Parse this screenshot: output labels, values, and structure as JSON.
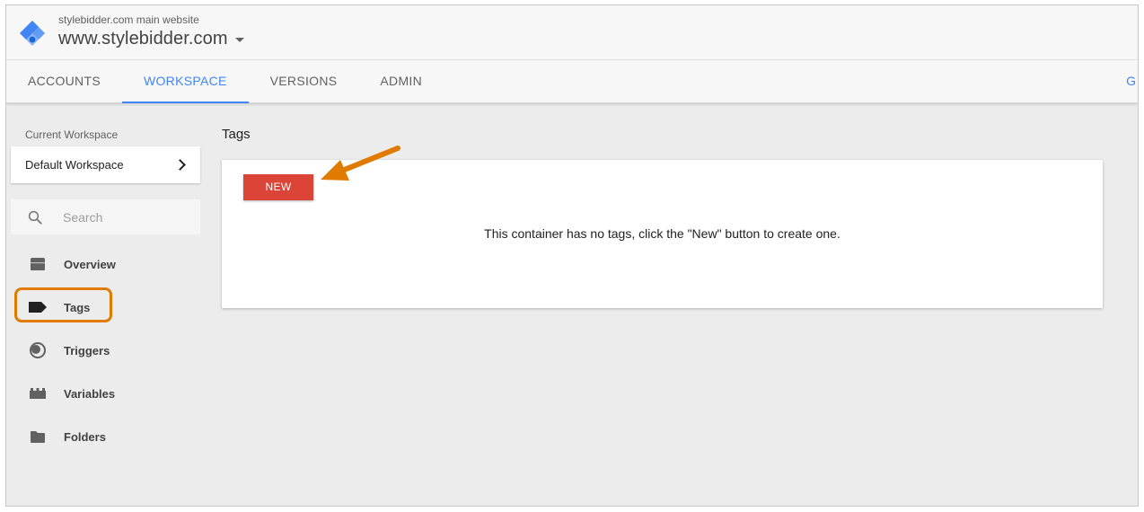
{
  "header": {
    "account_name": "stylebidder.com main website",
    "container_name": "www.stylebidder.com"
  },
  "tabs": [
    {
      "label": "ACCOUNTS",
      "active": false
    },
    {
      "label": "WORKSPACE",
      "active": true
    },
    {
      "label": "VERSIONS",
      "active": false
    },
    {
      "label": "ADMIN",
      "active": false
    }
  ],
  "tabs_right_partial": "G",
  "sidebar": {
    "current_workspace_label": "Current Workspace",
    "workspace_name": "Default Workspace",
    "search_placeholder": "Search",
    "items": [
      {
        "label": "Overview",
        "icon": "overview-icon"
      },
      {
        "label": "Tags",
        "icon": "tag-icon",
        "active": true
      },
      {
        "label": "Triggers",
        "icon": "trigger-icon"
      },
      {
        "label": "Variables",
        "icon": "variables-icon"
      },
      {
        "label": "Folders",
        "icon": "folder-icon"
      }
    ]
  },
  "main": {
    "title": "Tags",
    "new_button_label": "NEW",
    "empty_message": "This container has no tags, click the \"New\" button to create one."
  },
  "colors": {
    "accent_blue": "#4285f4",
    "new_button_red": "#db4437",
    "annotation_orange": "#e07b00"
  }
}
